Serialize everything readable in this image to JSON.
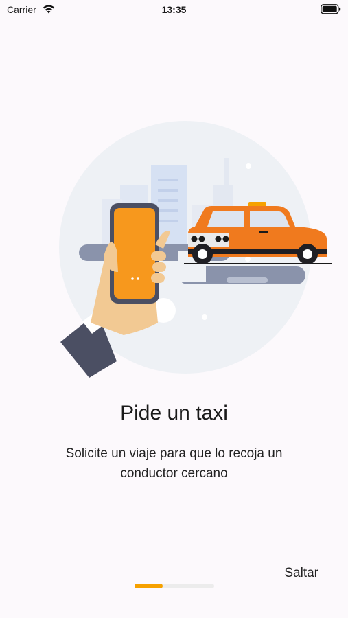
{
  "status_bar": {
    "carrier": "Carrier",
    "time": "13:35",
    "icons": [
      "wifi-icon",
      "battery-icon"
    ]
  },
  "onboarding": {
    "illustration": "taxi-hailing-illustration",
    "title": "Pide un taxi",
    "subtitle": "Solicite un viaje para que lo recoja un conductor cercano",
    "skip_label": "Saltar",
    "progress_fraction": 0.35
  },
  "colors": {
    "accent": "#f6a100",
    "taxi": "#f07a1e",
    "phone": "#f7981d",
    "background": "#fcf9fc"
  }
}
